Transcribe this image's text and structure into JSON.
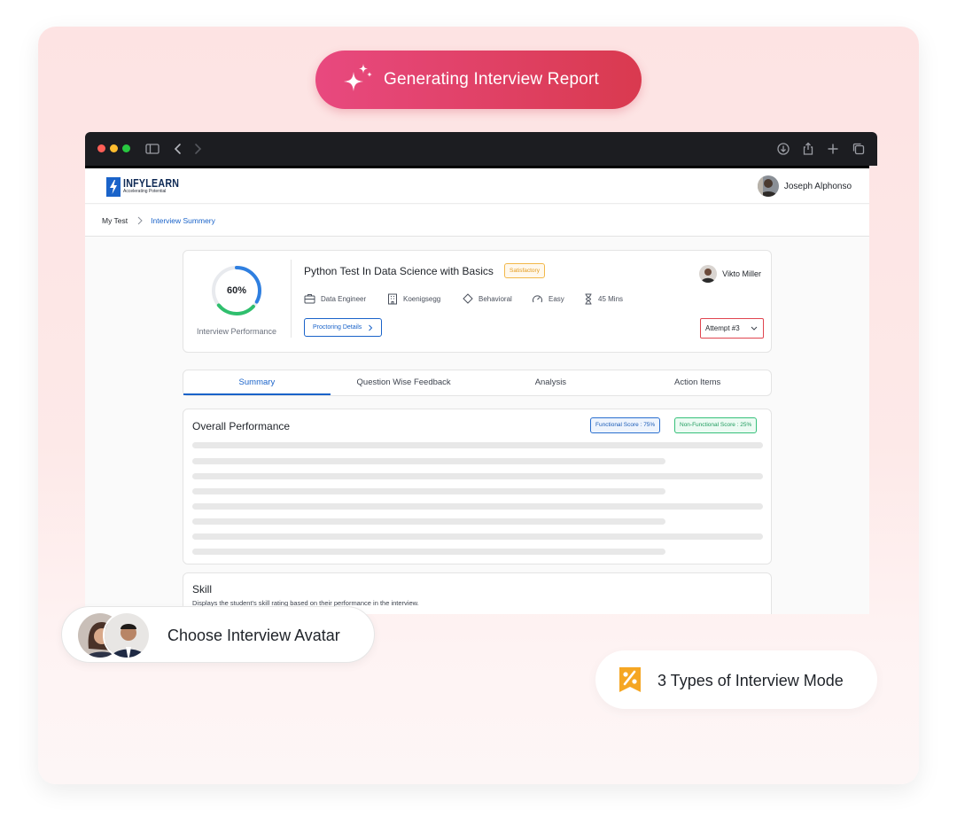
{
  "banner": {
    "title": "Generating Interview Report",
    "icon": "sparkle-icon"
  },
  "app": {
    "brand": {
      "name": "INFYLEARN",
      "tagline": "Accelerating Potential"
    },
    "user": {
      "name": "Joseph Alphonso"
    },
    "breadcrumb": {
      "root": "My Test",
      "current": "Interview Summery"
    }
  },
  "performance": {
    "percent_label": "60%",
    "percent": 60,
    "label": "Interview Performance",
    "test_title": "Python Test In Data Science with Basics",
    "status_badge": "Satisfactory",
    "meta": {
      "role": "Data Engineer",
      "company": "Koenigsegg",
      "type": "Behavioral",
      "difficulty": "Easy",
      "duration": "45 Mins"
    },
    "proctoring_button": "Proctoring Details",
    "candidate": "Vikto Miller",
    "attempt": "Attempt #3"
  },
  "tabs": [
    "Summary",
    "Question Wise Feedback",
    "Analysis",
    "Action Items"
  ],
  "active_tab": "Summary",
  "overall": {
    "title": "Overall Performance",
    "functional_score": "Functional Score : 75%",
    "non_functional_score": "Non-Functional Score : 25%"
  },
  "skill": {
    "title": "Skill",
    "description": "Displays the student's skill rating based on their performance in the interview."
  },
  "avatar_feature": {
    "label": "Choose Interview Avatar"
  },
  "mode_feature": {
    "label": "3 Types of Interview Mode",
    "icon": "percent-ribbon-icon"
  },
  "colors": {
    "brand_blue": "#1a63c9",
    "banner_pink": "#e8497f",
    "banner_red": "#d93a4f",
    "ring_blue": "#2f7fe0",
    "ring_green": "#2fbf6d",
    "satisfactory": "#f2b84a",
    "attempt_border": "#e0444f",
    "mode_icon": "#f5a623"
  }
}
